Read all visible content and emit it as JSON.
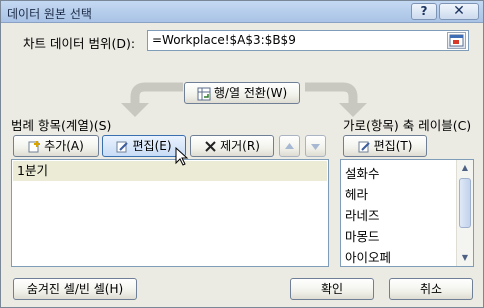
{
  "window": {
    "title": "데이터 원본 선택",
    "help_glyph": "?",
    "close_glyph": "✕"
  },
  "range": {
    "label": "차트 데이터 범위(D):",
    "value": "=Workplace!$A$3:$B$9"
  },
  "switch_button": {
    "label": "행/열 전환(W)"
  },
  "legend": {
    "label": "범례 항목(계열)(S)",
    "add_label": "추가(A)",
    "edit_label": "편집(E)",
    "remove_label": "제거(R)",
    "items": [
      "1분기"
    ]
  },
  "axis": {
    "label": "가로(항목) 축 레이블(C)",
    "edit_label": "편집(T)",
    "items": [
      "설화수",
      "헤라",
      "라네즈",
      "마몽드",
      "아이오페"
    ]
  },
  "footer": {
    "hidden_cells_label": "숨겨진 셀/빈 셀(H)",
    "ok_label": "확인",
    "cancel_label": "취소"
  },
  "colors": {
    "dialog_bg": "#ecebe3",
    "titlebar": "#b9d0ee",
    "selection": "#ecebd6",
    "input_border": "#7f9db9"
  }
}
